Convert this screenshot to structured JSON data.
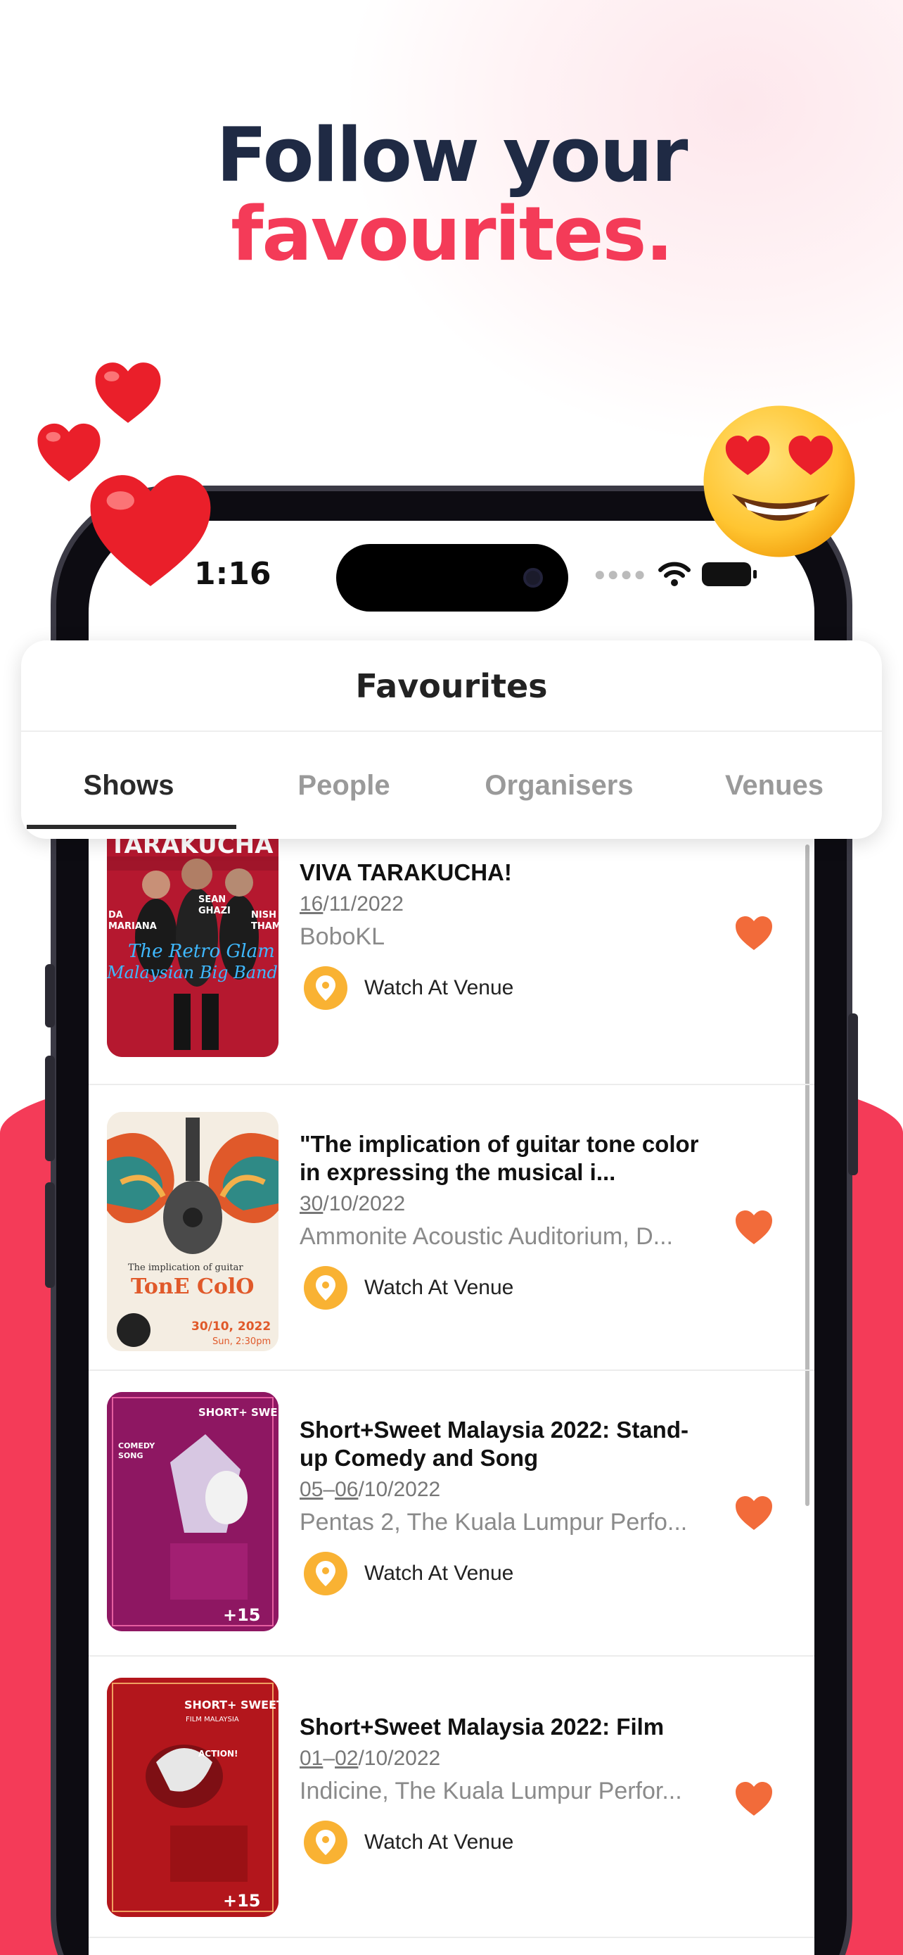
{
  "headline": {
    "line1": "Follow your",
    "line2": "favourites."
  },
  "status_bar": {
    "time": "1:16"
  },
  "screen": {
    "title": "Favourites",
    "tabs": [
      {
        "label": "Shows",
        "active": true
      },
      {
        "label": "People",
        "active": false
      },
      {
        "label": "Organisers",
        "active": false
      },
      {
        "label": "Venues",
        "active": false
      }
    ]
  },
  "shows": [
    {
      "title": "VIVA TARAKUCHA!",
      "date_prefix": "16",
      "date_rest": "/11/2022",
      "venue": "BoboKL",
      "watch_label": "Watch At Venue",
      "poster_text": [
        "TARAKUCHA",
        "SEAN GHAZI",
        "DA MARIANA",
        "NISH THAM",
        "The Retro Glam",
        "Malaysian Big Band"
      ]
    },
    {
      "title": "\"The implication of guitar tone color in expressing the musical i...",
      "date_prefix": "30",
      "date_rest": "/10/2022",
      "venue": "Ammonite Acoustic Auditorium, D...",
      "watch_label": "Watch At Venue",
      "poster_text": [
        "The implication of guitar",
        "TonE ColO",
        "30/10, 2022",
        "Sun, 2:30pm"
      ]
    },
    {
      "title": "Short+Sweet Malaysia 2022: Stand-up Comedy and Song",
      "date_prefix": "05",
      "date_sep": "–",
      "date_prefix2": "06",
      "date_rest": "/10/2022",
      "venue": "Pentas 2, The Kuala Lumpur Perfo...",
      "watch_label": "Watch At Venue",
      "poster_text": [
        "SHORT+ SWEET",
        "COMEDY",
        "SONG",
        "+15"
      ]
    },
    {
      "title": "Short+Sweet Malaysia 2022: Film",
      "date_prefix": "01",
      "date_sep": "–",
      "date_prefix2": "02",
      "date_rest": "/10/2022",
      "venue": "Indicine, The Kuala Lumpur Perfor...",
      "watch_label": "Watch At Venue",
      "poster_text": [
        "SHORT+ SWEET",
        "FILM MALAYSIA",
        "ACTION!",
        "+15"
      ]
    }
  ],
  "colors": {
    "accent": "#f43b58",
    "navy": "#1f2a44",
    "pin": "#f9b233",
    "heart": "#f26b3a"
  },
  "icons": [
    "heart-emoji-icon",
    "heart-eyes-emoji-icon",
    "location-pin-icon",
    "favourite-heart-icon",
    "wifi-icon",
    "battery-icon"
  ]
}
